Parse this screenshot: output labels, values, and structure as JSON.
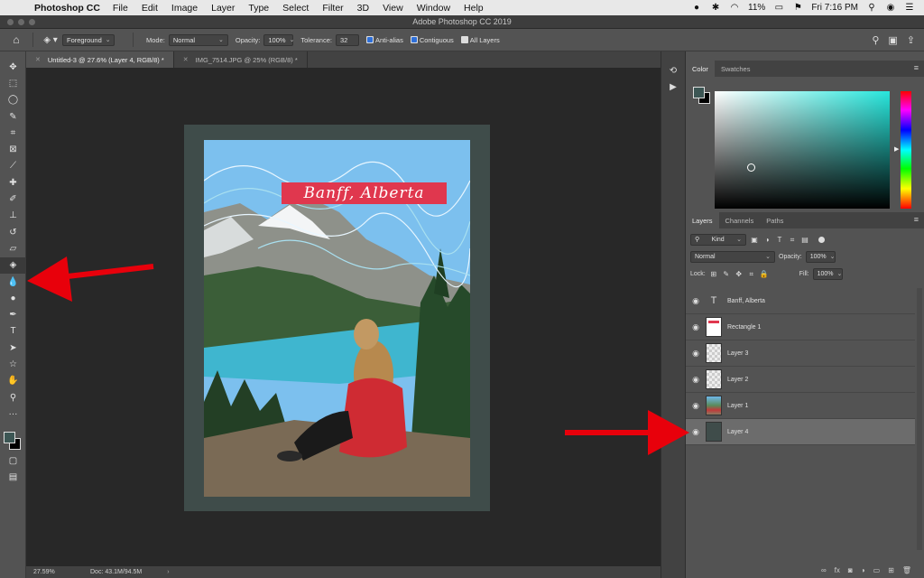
{
  "menubar": {
    "app_name": "Photoshop CC",
    "menus": [
      "File",
      "Edit",
      "Image",
      "Layer",
      "Type",
      "Select",
      "Filter",
      "3D",
      "View",
      "Window",
      "Help"
    ],
    "battery": "11%",
    "clock": "Fri 7:16 PM"
  },
  "window": {
    "title": "Adobe Photoshop CC 2019"
  },
  "options": {
    "fill_source": "Foreground",
    "mode_label": "Mode:",
    "mode_value": "Normal",
    "opacity_label": "Opacity:",
    "opacity_value": "100%",
    "tolerance_label": "Tolerance:",
    "tolerance_value": "32",
    "antialias_label": "Anti-alias",
    "contiguous_label": "Contiguous",
    "all_layers_label": "All Layers"
  },
  "tabs": [
    {
      "label": "Untitled-3 @ 27.6% (Layer 4, RGB/8) *"
    },
    {
      "label": "IMG_7514.JPG @ 25% (RGB/8) *"
    }
  ],
  "canvas": {
    "banner_text": "Banff, Alberta",
    "artboard_color": "#3f4c4a",
    "banner_color": "#e0374e"
  },
  "status": {
    "zoom": "27.59%",
    "doc": "Doc: 43.1M/94.5M"
  },
  "color_panel": {
    "tabs": [
      "Color",
      "Swatches"
    ],
    "foreground": "#3c5654",
    "background": "#000000"
  },
  "layers_panel": {
    "tabs": [
      "Layers",
      "Channels",
      "Paths"
    ],
    "filter_label": "Kind",
    "blend_mode": "Normal",
    "opacity_label": "Opacity:",
    "opacity_value": "100%",
    "lock_label": "Lock:",
    "fill_label": "Fill:",
    "fill_value": "100%",
    "layers": [
      {
        "name": "Banff, Alberta",
        "kind": "text"
      },
      {
        "name": "Rectangle 1",
        "kind": "shape"
      },
      {
        "name": "Layer 3",
        "kind": "pixel"
      },
      {
        "name": "Layer 2",
        "kind": "pixel"
      },
      {
        "name": "Layer 1",
        "kind": "photo"
      },
      {
        "name": "Layer 4",
        "kind": "fill",
        "selected": true
      }
    ]
  },
  "annotations": {
    "arrow_color": "#e8000b"
  }
}
